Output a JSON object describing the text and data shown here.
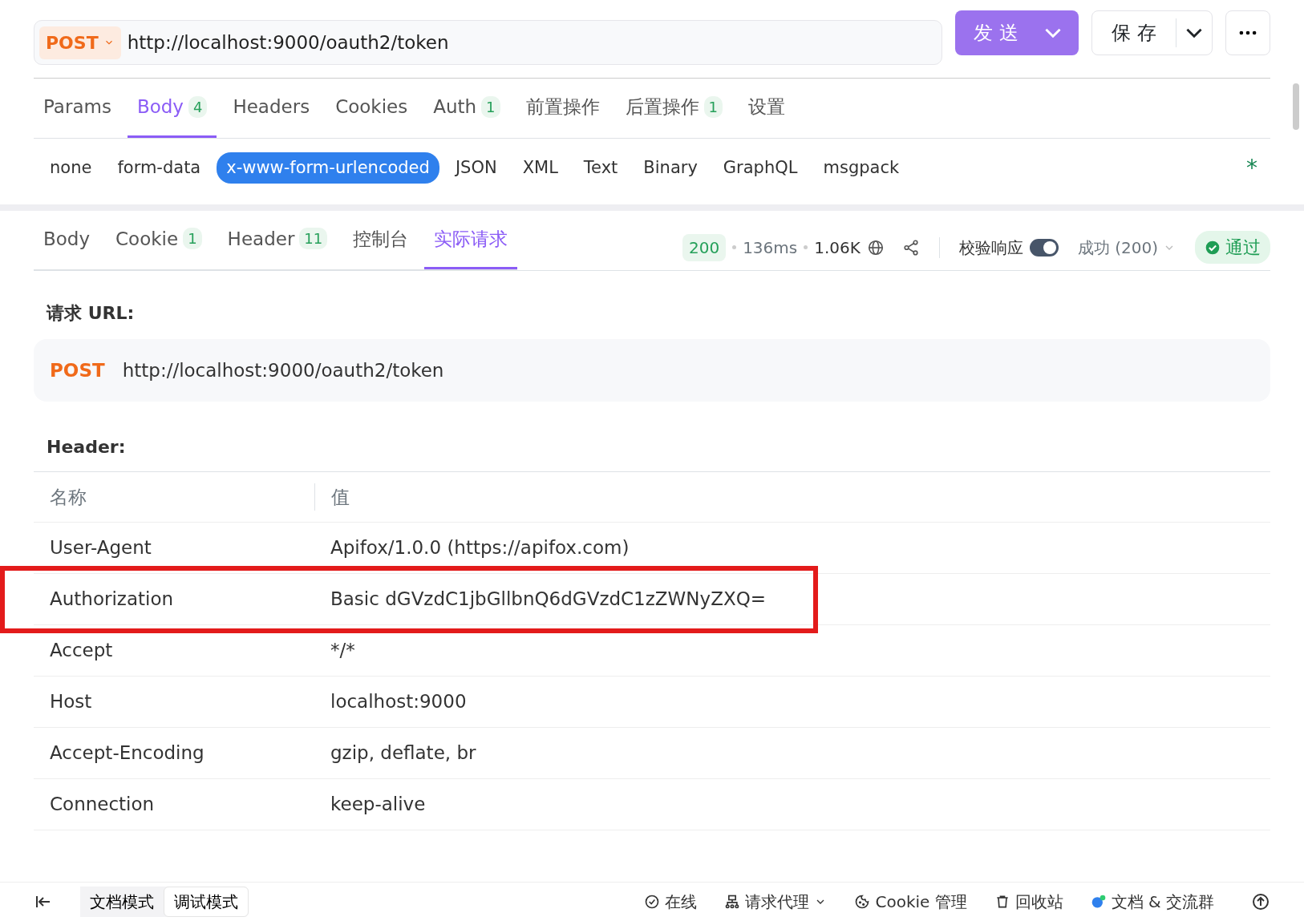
{
  "request_bar": {
    "method": "POST",
    "url": "http://localhost:9000/oauth2/token",
    "send_label": "发 送",
    "save_label": "保 存"
  },
  "request_tabs": [
    {
      "label": "Params",
      "selected": false
    },
    {
      "label": "Body",
      "count": "4",
      "selected": true
    },
    {
      "label": "Headers",
      "selected": false
    },
    {
      "label": "Cookies",
      "selected": false
    },
    {
      "label": "Auth",
      "count": "1",
      "selected": false
    },
    {
      "label": "前置操作",
      "selected": false
    },
    {
      "label": "后置操作",
      "count": "1",
      "selected": false
    },
    {
      "label": "设置",
      "selected": false
    }
  ],
  "body_types": [
    {
      "label": "none",
      "selected": false
    },
    {
      "label": "form-data",
      "selected": false
    },
    {
      "label": "x-www-form-urlencoded",
      "selected": true
    },
    {
      "label": "JSON",
      "selected": false
    },
    {
      "label": "XML",
      "selected": false
    },
    {
      "label": "Text",
      "selected": false
    },
    {
      "label": "Binary",
      "selected": false
    },
    {
      "label": "GraphQL",
      "selected": false
    },
    {
      "label": "msgpack",
      "selected": false
    }
  ],
  "body_marker": "*",
  "response_tabs": [
    {
      "label": "Body",
      "selected": false
    },
    {
      "label": "Cookie",
      "count": "1",
      "selected": false
    },
    {
      "label": "Header",
      "count": "11",
      "selected": false
    },
    {
      "label": "控制台",
      "selected": false
    },
    {
      "label": "实际请求",
      "selected": true
    }
  ],
  "response_meta": {
    "status": "200",
    "time": "136ms",
    "size": "1.06K",
    "validate_label": "校验响应",
    "validate_on": true,
    "expected": "成功 (200)",
    "result": "通过"
  },
  "actual_request": {
    "url_heading": "请求 URL:",
    "method": "POST",
    "url": "http://localhost:9000/oauth2/token",
    "header_heading": "Header:",
    "columns": [
      "名称",
      "值"
    ],
    "rows": [
      {
        "name": "User-Agent",
        "value": "Apifox/1.0.0 (https://apifox.com)",
        "highlighted": false
      },
      {
        "name": "Authorization",
        "value": "Basic dGVzdC1jbGllbnQ6dGVzdC1zZWNyZXQ=",
        "highlighted": true
      },
      {
        "name": "Accept",
        "value": "*/*",
        "highlighted": false
      },
      {
        "name": "Host",
        "value": "localhost:9000",
        "highlighted": false
      },
      {
        "name": "Accept-Encoding",
        "value": "gzip, deflate, br",
        "highlighted": false
      },
      {
        "name": "Connection",
        "value": "keep-alive",
        "highlighted": false
      }
    ]
  },
  "status_bar": {
    "modes": [
      {
        "label": "文档模式",
        "selected": false
      },
      {
        "label": "调试模式",
        "selected": true
      }
    ],
    "items": [
      {
        "kind": "online",
        "label": "在线"
      },
      {
        "kind": "proxy",
        "label": "请求代理"
      },
      {
        "kind": "cookie",
        "label": "Cookie 管理"
      },
      {
        "kind": "trash",
        "label": "回收站"
      },
      {
        "kind": "chat",
        "label": "文档 & 交流群"
      }
    ]
  }
}
